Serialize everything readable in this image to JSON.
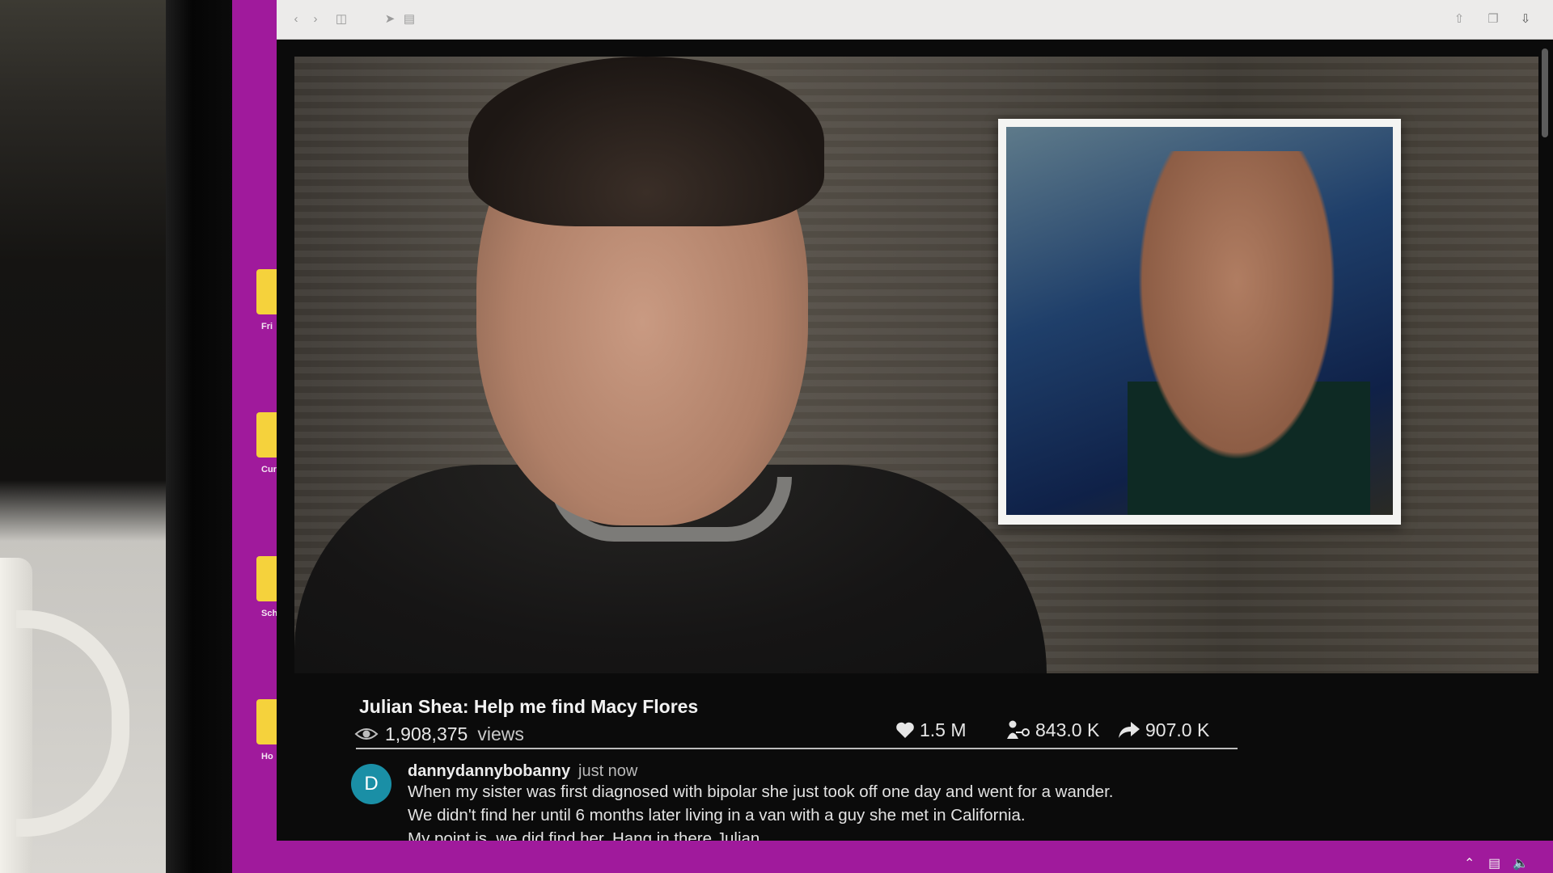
{
  "desktop": {
    "icons": [
      {
        "label": "Fri",
        "icon": "folder-icon"
      },
      {
        "label": "Cur",
        "icon": "folder-icon"
      },
      {
        "label": "Sch",
        "icon": "folder-icon"
      },
      {
        "label": "Ho",
        "icon": "folder-icon"
      }
    ]
  },
  "video": {
    "title": "Julian Shea: Help me find Macy Flores",
    "views_count": "1,908,375",
    "views_word": "views",
    "likes": "1.5 M",
    "connections": "843.0 K",
    "shares": "907.0 K"
  },
  "comment": {
    "avatar_letter": "D",
    "avatar_color": "#1a8fa6",
    "author": "dannydannybobanny",
    "timestamp": "just now",
    "lines": [
      "When my sister was first diagnosed with bipolar she just took off one day and went for a wander.",
      "We didn't find her until 6 months later living in a van with a guy she met in California.",
      "My point is, we did find her.  Hang in there Julian."
    ]
  },
  "colors": {
    "desktop": "#a01a9c",
    "panel": "#0b0b0b"
  }
}
